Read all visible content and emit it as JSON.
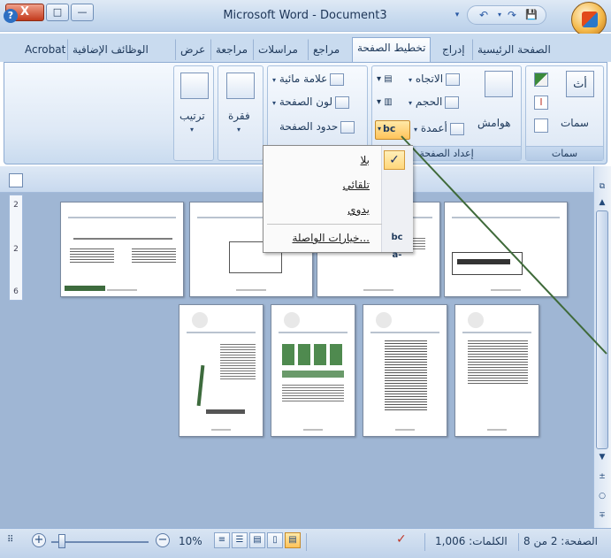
{
  "window": {
    "title": "Microsoft Word - Document3",
    "close": "X",
    "maximize": "□",
    "minimize": "—"
  },
  "quick_access": {
    "undo": "↶",
    "undo_arrow": "▾",
    "redo": "↷",
    "save": "💾",
    "menu": "▾"
  },
  "tabs": [
    "الصفحة الرئيسية",
    "إدراج",
    "تخطيط الصفحة",
    "مراجع",
    "مراسلات",
    "مراجعة",
    "عرض",
    "الوظائف الإضافية",
    "Acrobat"
  ],
  "active_tab": "تخطيط الصفحة",
  "help": "?",
  "ribbon": {
    "themes": {
      "label": "سمات",
      "themes_button": "سمات",
      "icon_text": "أث"
    },
    "page_setup": {
      "label": "إعداد الصفحة",
      "margins": "هوامش",
      "orientation": "الاتجاه",
      "size": "الحجم",
      "columns": "أعمدة"
    },
    "page_background": {
      "watermark": "علامة مائية",
      "page_color": "لون الصفحة",
      "page_borders": "حدود الصفحة"
    },
    "paragraph": {
      "label": "فقرة"
    },
    "arrange": {
      "label": "ترتيب"
    }
  },
  "hyphenation_menu": {
    "items": [
      "بلا",
      "تلقائي",
      "يدوي"
    ],
    "options": "خيارات الواصلة...",
    "checked": "✓",
    "options_icon": "bc a-"
  },
  "ruler": {
    "numbers": [
      "2",
      "2",
      "6"
    ]
  },
  "statusbar": {
    "page": "الصفحة: 2 من 8",
    "words": "الكلمات: 1,006",
    "zoom": "10%",
    "zoom_in": "+",
    "zoom_out": "−"
  },
  "accent_colors": {
    "highlight": "#ffc35a",
    "ribbon": "#dde8f5",
    "doc_bg": "#9fb6d4"
  }
}
